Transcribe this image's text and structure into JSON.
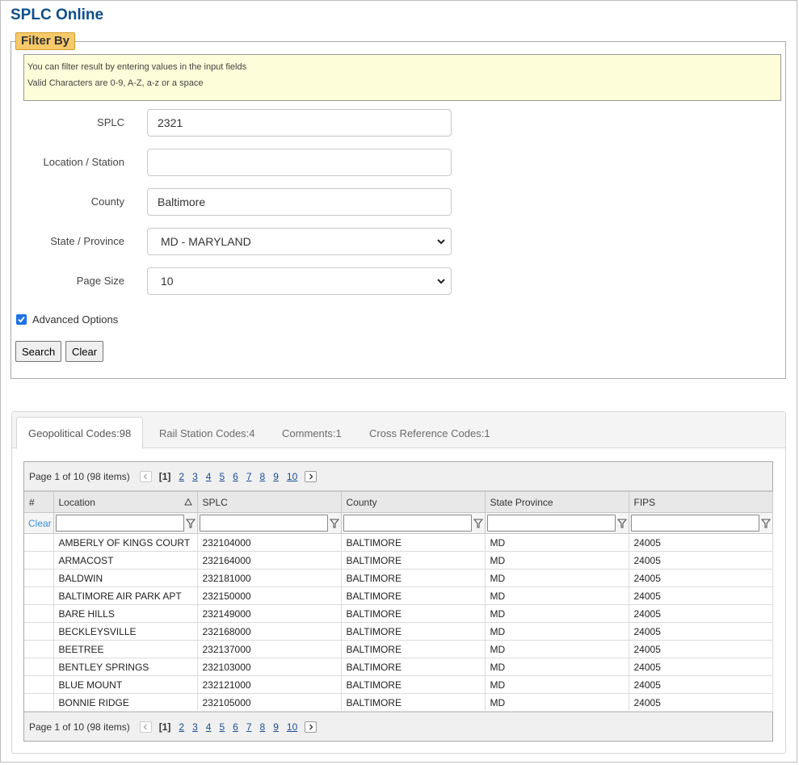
{
  "app": {
    "title": "SPLC Online"
  },
  "filter": {
    "legend": "Filter By",
    "info_line1": "You can filter result by entering values in the input fields",
    "info_line2": "Valid Characters are 0-9, A-Z, a-z or a space",
    "fields": {
      "splc": {
        "label": "SPLC",
        "value": "2321"
      },
      "location": {
        "label": "Location / Station",
        "value": ""
      },
      "county": {
        "label": "County",
        "value": "Baltimore"
      },
      "state": {
        "label": "State / Province",
        "value": "MD - MARYLAND"
      },
      "page_size": {
        "label": "Page Size",
        "value": "10"
      }
    },
    "advanced_label": "Advanced Options",
    "advanced_checked": true,
    "search_label": "Search",
    "clear_label": "Clear"
  },
  "tabs": [
    {
      "label": "Geopolitical Codes:98",
      "active": true
    },
    {
      "label": "Rail Station Codes:4",
      "active": false
    },
    {
      "label": "Comments:1",
      "active": false
    },
    {
      "label": "Cross Reference Codes:1",
      "active": false
    }
  ],
  "pager": {
    "info": "Page 1 of 10 (98 items)",
    "current": "[1]",
    "pages": [
      "2",
      "3",
      "4",
      "5",
      "6",
      "7",
      "8",
      "9",
      "10"
    ]
  },
  "grid": {
    "columns": {
      "num": "#",
      "location": "Location",
      "splc": "SPLC",
      "county": "County",
      "state": "State Province",
      "fips": "FIPS"
    },
    "clear_label": "Clear",
    "rows": [
      {
        "location": "AMBERLY OF KINGS COURT",
        "splc": "232104000",
        "county": "BALTIMORE",
        "state": "MD",
        "fips": "24005"
      },
      {
        "location": "ARMACOST",
        "splc": "232164000",
        "county": "BALTIMORE",
        "state": "MD",
        "fips": "24005"
      },
      {
        "location": "BALDWIN",
        "splc": "232181000",
        "county": "BALTIMORE",
        "state": "MD",
        "fips": "24005"
      },
      {
        "location": "BALTIMORE AIR PARK APT",
        "splc": "232150000",
        "county": "BALTIMORE",
        "state": "MD",
        "fips": "24005"
      },
      {
        "location": "BARE HILLS",
        "splc": "232149000",
        "county": "BALTIMORE",
        "state": "MD",
        "fips": "24005"
      },
      {
        "location": "BECKLEYSVILLE",
        "splc": "232168000",
        "county": "BALTIMORE",
        "state": "MD",
        "fips": "24005"
      },
      {
        "location": "BEETREE",
        "splc": "232137000",
        "county": "BALTIMORE",
        "state": "MD",
        "fips": "24005"
      },
      {
        "location": "BENTLEY SPRINGS",
        "splc": "232103000",
        "county": "BALTIMORE",
        "state": "MD",
        "fips": "24005"
      },
      {
        "location": "BLUE MOUNT",
        "splc": "232121000",
        "county": "BALTIMORE",
        "state": "MD",
        "fips": "24005"
      },
      {
        "location": "BONNIE RIDGE",
        "splc": "232105000",
        "county": "BALTIMORE",
        "state": "MD",
        "fips": "24005"
      }
    ]
  }
}
